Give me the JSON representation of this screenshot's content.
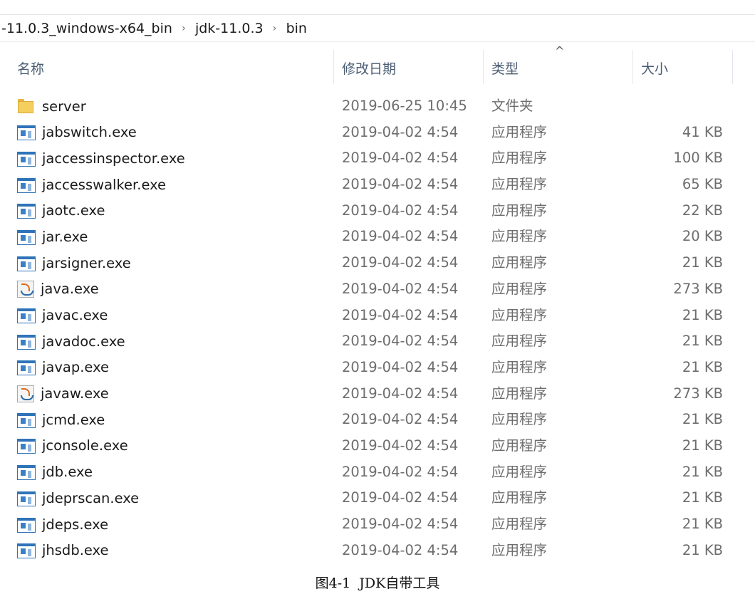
{
  "breadcrumb": {
    "segments": [
      "-11.0.3_windows-x64_bin",
      "jdk-11.0.3",
      "bin"
    ]
  },
  "columns": {
    "name": "名称",
    "modified": "修改日期",
    "type": "类型",
    "size": "大小",
    "sort_indicator": "^",
    "sorted_column": "type"
  },
  "files": [
    {
      "name": "server",
      "modified": "2019-06-25 10:45",
      "type": "文件夹",
      "size": "",
      "icon": "folder-icon"
    },
    {
      "name": "jabswitch.exe",
      "modified": "2019-04-02 4:54",
      "type": "应用程序",
      "size": "41 KB",
      "icon": "app-icon"
    },
    {
      "name": "jaccessinspector.exe",
      "modified": "2019-04-02 4:54",
      "type": "应用程序",
      "size": "100 KB",
      "icon": "app-icon"
    },
    {
      "name": "jaccesswalker.exe",
      "modified": "2019-04-02 4:54",
      "type": "应用程序",
      "size": "65 KB",
      "icon": "app-icon"
    },
    {
      "name": "jaotc.exe",
      "modified": "2019-04-02 4:54",
      "type": "应用程序",
      "size": "22 KB",
      "icon": "app-icon"
    },
    {
      "name": "jar.exe",
      "modified": "2019-04-02 4:54",
      "type": "应用程序",
      "size": "20 KB",
      "icon": "app-icon"
    },
    {
      "name": "jarsigner.exe",
      "modified": "2019-04-02 4:54",
      "type": "应用程序",
      "size": "21 KB",
      "icon": "app-icon"
    },
    {
      "name": "java.exe",
      "modified": "2019-04-02 4:54",
      "type": "应用程序",
      "size": "273 KB",
      "icon": "java-icon"
    },
    {
      "name": "javac.exe",
      "modified": "2019-04-02 4:54",
      "type": "应用程序",
      "size": "21 KB",
      "icon": "app-icon"
    },
    {
      "name": "javadoc.exe",
      "modified": "2019-04-02 4:54",
      "type": "应用程序",
      "size": "21 KB",
      "icon": "app-icon"
    },
    {
      "name": "javap.exe",
      "modified": "2019-04-02 4:54",
      "type": "应用程序",
      "size": "21 KB",
      "icon": "app-icon"
    },
    {
      "name": "javaw.exe",
      "modified": "2019-04-02 4:54",
      "type": "应用程序",
      "size": "273 KB",
      "icon": "java-icon"
    },
    {
      "name": "jcmd.exe",
      "modified": "2019-04-02 4:54",
      "type": "应用程序",
      "size": "21 KB",
      "icon": "app-icon"
    },
    {
      "name": "jconsole.exe",
      "modified": "2019-04-02 4:54",
      "type": "应用程序",
      "size": "21 KB",
      "icon": "app-icon"
    },
    {
      "name": "jdb.exe",
      "modified": "2019-04-02 4:54",
      "type": "应用程序",
      "size": "21 KB",
      "icon": "app-icon"
    },
    {
      "name": "jdeprscan.exe",
      "modified": "2019-04-02 4:54",
      "type": "应用程序",
      "size": "21 KB",
      "icon": "app-icon"
    },
    {
      "name": "jdeps.exe",
      "modified": "2019-04-02 4:54",
      "type": "应用程序",
      "size": "21 KB",
      "icon": "app-icon"
    },
    {
      "name": "jhsdb.exe",
      "modified": "2019-04-02 4:54",
      "type": "应用程序",
      "size": "21 KB",
      "icon": "app-icon"
    }
  ],
  "caption": "图4-1 JDK自带工具",
  "colors": {
    "header_text": "#4b5d73",
    "secondary_text": "#6d6d6d",
    "folder": "#f5cf5e",
    "app_icon": "#2f73b8"
  }
}
